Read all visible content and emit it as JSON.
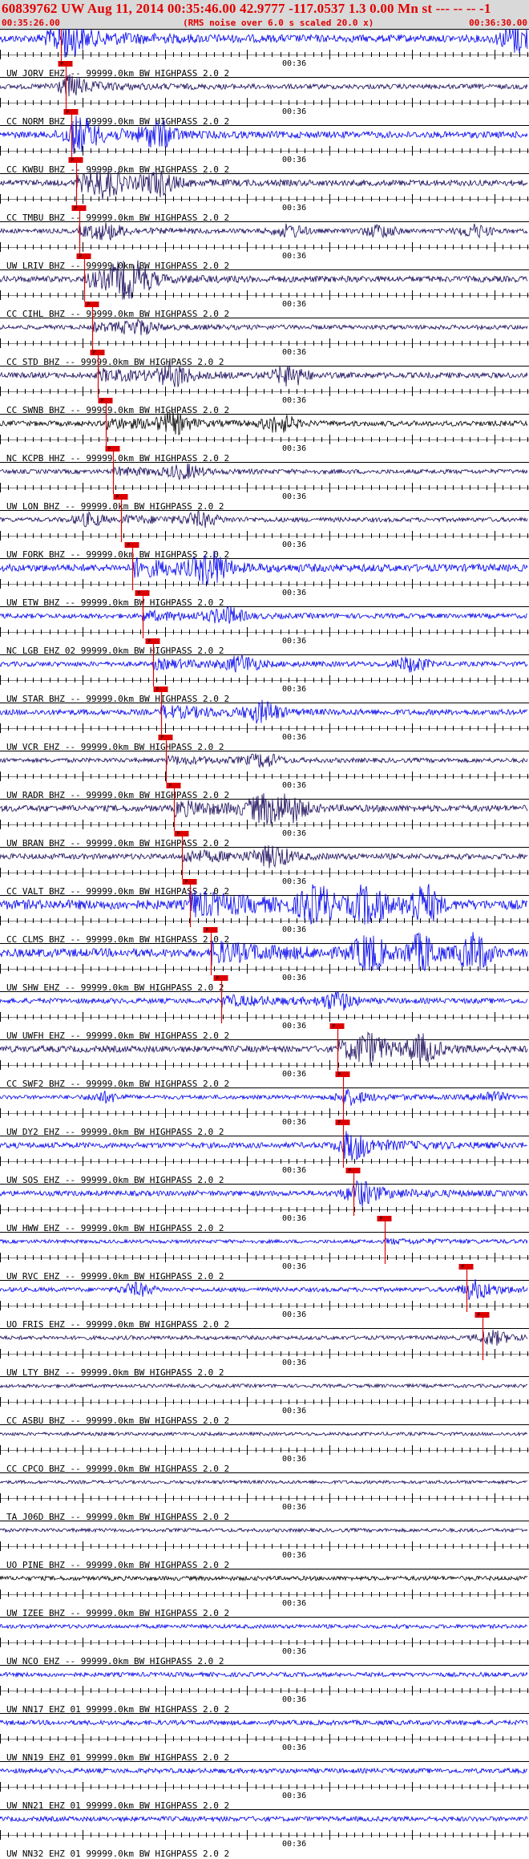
{
  "header": {
    "title": "60839762 UW Aug 11, 2014 00:35:46.00   42.9777 -117.0537  1.3 0.00 Mn st --- -- --  -1",
    "start_time": "00:35:26.00",
    "note": "(RMS noise over 6.0 s scaled 20.0 x)",
    "end_time": "00:36:30.00"
  },
  "colors": {
    "trace_blue": "#0000ee",
    "trace_dark": "#1a0a5a",
    "trace_black": "#000000",
    "pick": "#dd0000",
    "header_bg": "#d9d9d9",
    "header_text": "#e00000"
  },
  "chart_data": {
    "type": "seismogram-record-section",
    "time_range": [
      "00:35:26.00",
      "00:36:30.00"
    ],
    "minute_tick_label": "00:36",
    "pick_label": "P",
    "channels": [
      {
        "label": "UW JORV EHZ -- 99999.0km BW  HIGHPASS  2.0  2",
        "pick": 0.115,
        "amp": 1.2,
        "color": "blue",
        "events": [
          0.12,
          0.98
        ]
      },
      {
        "label": "CC NORM BHZ -- 99999.0km BW  HIGHPASS  2.0  2",
        "pick": 0.125,
        "amp": 0.6,
        "color": "dark",
        "events": [
          0.13
        ]
      },
      {
        "label": "CC KWBU BHZ -- 99999.0km BW  HIGHPASS  2.0  2",
        "pick": 0.135,
        "amp": 1.0,
        "color": "blue",
        "events": [
          0.15,
          0.3
        ]
      },
      {
        "label": "CC TMBU BHZ -- 99999.0km BW  HIGHPASS  2.0  2",
        "pick": 0.145,
        "amp": 0.9,
        "color": "dark",
        "events": [
          0.2,
          0.3
        ]
      },
      {
        "label": "UW LRIV BHZ -- 99999.0km BW  HIGHPASS  2.0  2",
        "pick": 0.15,
        "amp": 0.5,
        "color": "dark",
        "events": [
          0.2,
          0.55,
          0.72,
          0.9
        ]
      },
      {
        "label": "CC CIHL BHZ -- 99999.0km BW  HIGHPASS  2.0  2",
        "pick": 0.16,
        "amp": 0.9,
        "color": "dark",
        "events": [
          0.23,
          0.26
        ]
      },
      {
        "label": "CC STD BHZ -- 99999.0km BW  HIGHPASS  2.0  2",
        "pick": 0.175,
        "amp": 0.5,
        "color": "dark",
        "events": [
          0.26
        ]
      },
      {
        "label": "CC SWNB BHZ -- 99999.0km BW  HIGHPASS  2.0  2",
        "pick": 0.185,
        "amp": 0.8,
        "color": "dark",
        "events": [
          0.33,
          0.55
        ]
      },
      {
        "label": "NC KCPB HHZ -- 99999.0km BW  HIGHPASS  2.0  2",
        "pick": 0.2,
        "amp": 0.7,
        "color": "black",
        "events": [
          0.33,
          0.53
        ]
      },
      {
        "label": "UW LON BHZ -- 99999.0km BW  HIGHPASS  2.0  2",
        "pick": 0.215,
        "amp": 0.5,
        "color": "dark",
        "events": [
          0.35
        ]
      },
      {
        "label": "UW FORK BHZ -- 99999.0km BW  HIGHPASS  2.0  2",
        "pick": 0.23,
        "amp": 0.5,
        "color": "dark",
        "events": [
          0.17,
          0.38
        ]
      },
      {
        "label": "UW ETW BHZ -- 99999.0km BW  HIGHPASS  2.0  2",
        "pick": 0.25,
        "amp": 1.2,
        "color": "blue",
        "events": [
          0.4
        ]
      },
      {
        "label": "NC LGB EHZ 02 99999.0km BW  HIGHPASS  2.0  2",
        "pick": 0.27,
        "amp": 0.6,
        "color": "blue",
        "events": [
          0.43
        ]
      },
      {
        "label": "UW STAR BHZ -- 99999.0km BW  HIGHPASS  2.0  2",
        "pick": 0.29,
        "amp": 0.6,
        "color": "blue",
        "events": [
          0.46,
          0.78
        ]
      },
      {
        "label": "UW VCR EHZ -- 99999.0km BW  HIGHPASS  2.0  2",
        "pick": 0.305,
        "amp": 0.8,
        "color": "blue",
        "events": [
          0.5
        ]
      },
      {
        "label": "UW RADR BHZ -- 99999.0km BW  HIGHPASS  2.0  2",
        "pick": 0.315,
        "amp": 0.5,
        "color": "dark",
        "events": [
          0.5
        ]
      },
      {
        "label": "UW BRAN BHZ -- 99999.0km BW  HIGHPASS  2.0  2",
        "pick": 0.33,
        "amp": 1.0,
        "color": "dark",
        "events": [
          0.5,
          0.55
        ]
      },
      {
        "label": "CC VALT BHZ -- 99999.0km BW  HIGHPASS  2.0  2",
        "pick": 0.345,
        "amp": 0.8,
        "color": "dark",
        "events": [
          0.52
        ]
      },
      {
        "label": "CC CLMS BHZ -- 99999.0km BW  HIGHPASS  2.0  2",
        "pick": 0.36,
        "amp": 1.8,
        "color": "blue",
        "events": [
          0.6,
          0.7,
          0.8
        ]
      },
      {
        "label": "UW SHW EHZ -- 99999.0km BW  HIGHPASS  2.0  2",
        "pick": 0.4,
        "amp": 1.5,
        "color": "blue",
        "events": [
          0.7,
          0.8,
          0.9
        ]
      },
      {
        "label": "UW UWFH EHZ -- 99999.0km BW  HIGHPASS  2.0  2",
        "pick": 0.42,
        "amp": 0.7,
        "color": "blue",
        "events": [
          0.64
        ]
      },
      {
        "label": "CC SWF2 BHZ -- 99999.0km BW  HIGHPASS  2.0  2",
        "pick": 0.64,
        "amp": 1.0,
        "color": "dark",
        "events": [
          0.7,
          0.8
        ]
      },
      {
        "label": "UW DY2 EHZ -- 99999.0km BW  HIGHPASS  2.0  2",
        "pick": 0.65,
        "amp": 0.4,
        "color": "blue",
        "events": [
          0.2,
          0.66,
          0.93
        ]
      },
      {
        "label": "UW SOS EHZ -- 99999.0km BW  HIGHPASS  2.0  2",
        "pick": 0.65,
        "amp": 0.8,
        "color": "blue",
        "events": [
          0.67
        ]
      },
      {
        "label": "UW HWW EHZ -- 99999.0km BW  HIGHPASS  2.0  2",
        "pick": 0.67,
        "amp": 0.7,
        "color": "blue",
        "events": [
          0.68
        ]
      },
      {
        "label": "UW RVC EHZ -- 99999.0km BW  HIGHPASS  2.0  2",
        "pick": 0.73,
        "amp": 0.3,
        "color": "blue",
        "events": []
      },
      {
        "label": "UO FRIS EHZ -- 99999.0km BW  HIGHPASS  2.0  2",
        "pick": 0.885,
        "amp": 0.5,
        "color": "blue",
        "events": [
          0.26,
          0.9
        ]
      },
      {
        "label": "UW LTY BHZ -- 99999.0km BW  HIGHPASS  2.0  2",
        "pick": 0.915,
        "amp": 0.4,
        "color": "dark",
        "events": [
          0.93
        ]
      },
      {
        "label": "CC ASBU BHZ -- 99999.0km BW  HIGHPASS  2.0  2",
        "pick": null,
        "amp": 0.3,
        "color": "dark",
        "events": []
      },
      {
        "label": "CC CPCO BHZ -- 99999.0km BW  HIGHPASS  2.0  2",
        "pick": null,
        "amp": 0.25,
        "color": "dark",
        "events": []
      },
      {
        "label": "TA J06D BHZ -- 99999.0km BW  HIGHPASS  2.0  2",
        "pick": null,
        "amp": 0.25,
        "color": "dark",
        "events": []
      },
      {
        "label": "UO PINE BHZ -- 99999.0km BW  HIGHPASS  2.0  2",
        "pick": null,
        "amp": 0.3,
        "color": "dark",
        "events": []
      },
      {
        "label": "UW IZEE BHZ -- 99999.0km BW  HIGHPASS  2.0  2",
        "pick": null,
        "amp": 0.5,
        "color": "black",
        "events": []
      },
      {
        "label": "UW NCO EHZ -- 99999.0km BW  HIGHPASS  2.0  2",
        "pick": null,
        "amp": 0.4,
        "color": "blue",
        "events": []
      },
      {
        "label": "UW NN17 EHZ 01 99999.0km BW  HIGHPASS  2.0  2",
        "pick": null,
        "amp": 0.5,
        "color": "blue",
        "events": []
      },
      {
        "label": "UW NN19 EHZ 01 99999.0km BW  HIGHPASS  2.0  2",
        "pick": null,
        "amp": 0.6,
        "color": "blue",
        "events": []
      },
      {
        "label": "UW NN21 EHZ 01 99999.0km BW  HIGHPASS  2.0  2",
        "pick": null,
        "amp": 0.6,
        "color": "blue",
        "events": []
      },
      {
        "label": "UW NN32 EHZ 01 99999.0km BW  HIGHPASS  2.0  2",
        "pick": null,
        "amp": 0.6,
        "color": "blue",
        "events": []
      }
    ]
  }
}
